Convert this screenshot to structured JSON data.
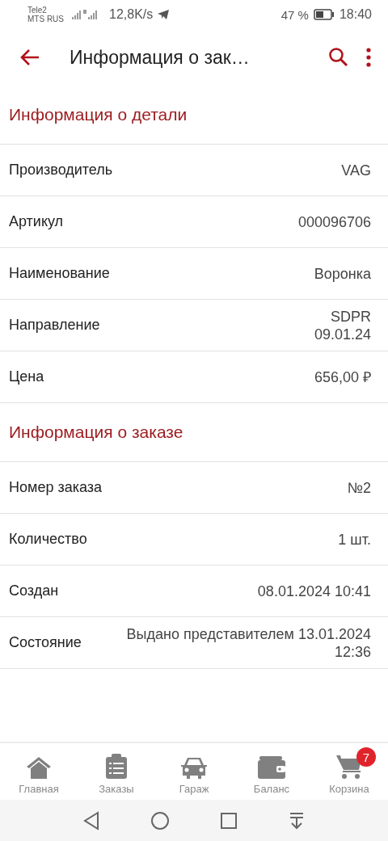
{
  "status_bar": {
    "carriers": [
      "Tele2",
      "MTS RUS"
    ],
    "speed": "12,8K/s",
    "battery": "47 %",
    "time": "18:40"
  },
  "app_bar": {
    "title": "Информация о зак…"
  },
  "sections": [
    {
      "title": "Информация о детали",
      "rows": [
        {
          "label": "Производитель",
          "value": "VAG"
        },
        {
          "label": "Артикул",
          "value": "000096706"
        },
        {
          "label": "Наименование",
          "value": "Воронка"
        },
        {
          "label": "Направление",
          "value": "SDPR\n09.01.24"
        },
        {
          "label": "Цена",
          "value": "656,00 ₽"
        }
      ]
    },
    {
      "title": "Информация о заказе",
      "rows": [
        {
          "label": "Номер заказа",
          "value": "№2"
        },
        {
          "label": "Количество",
          "value": "1 шт."
        },
        {
          "label": "Создан",
          "value": "08.01.2024 10:41"
        },
        {
          "label": "Состояние",
          "value": "Выдано представителем 13.01.2024\n12:36"
        }
      ]
    }
  ],
  "bottom_nav": [
    {
      "kind": "home",
      "label": "Главная",
      "selected": false
    },
    {
      "kind": "orders",
      "label": "Заказы",
      "selected": false
    },
    {
      "kind": "garage",
      "label": "Гараж",
      "selected": false
    },
    {
      "kind": "balance",
      "label": "Баланс",
      "selected": false
    },
    {
      "kind": "cart",
      "label": "Корзина",
      "selected": false,
      "badge": "7"
    }
  ]
}
